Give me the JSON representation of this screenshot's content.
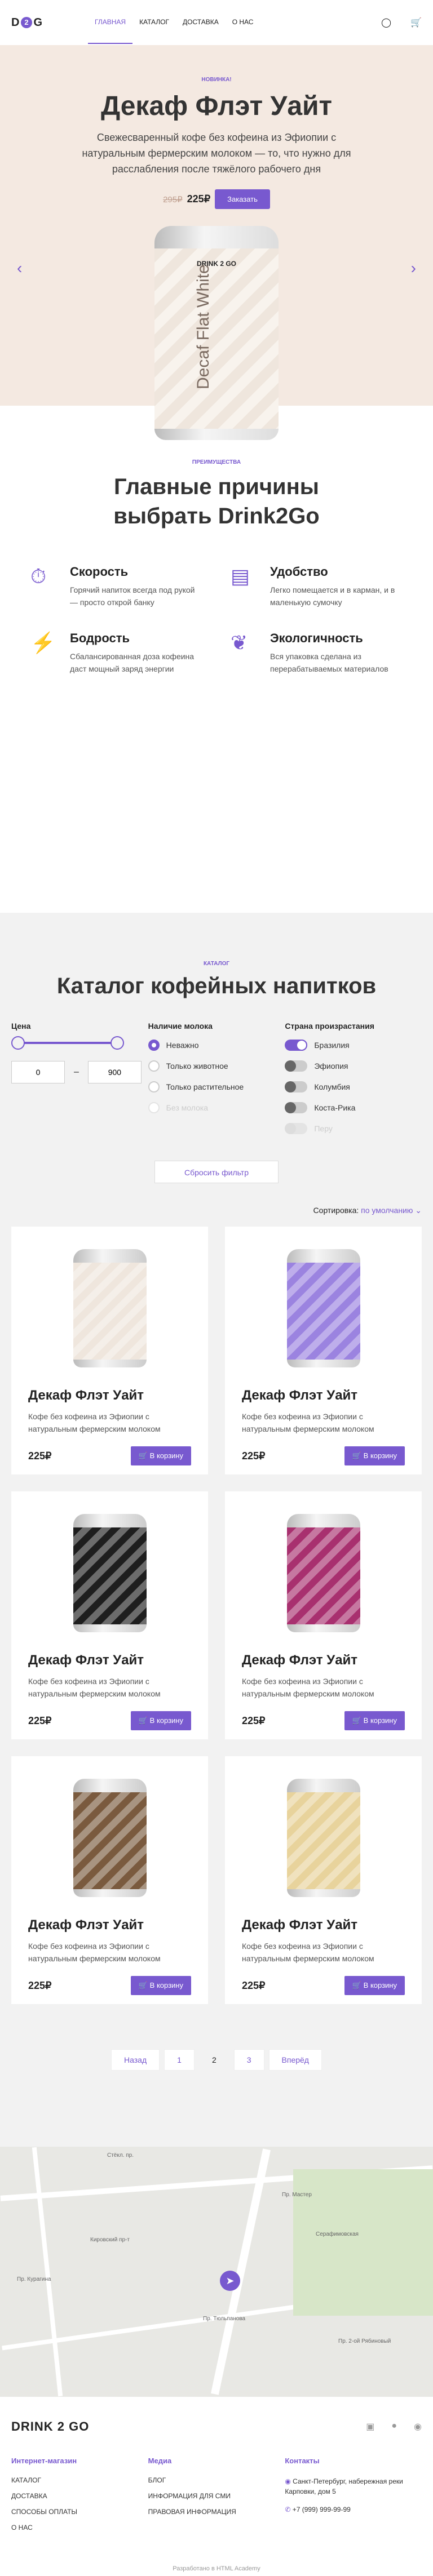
{
  "header": {
    "logo_left": "D",
    "logo_o": "2",
    "logo_right": "G",
    "nav": [
      "ГЛАВНАЯ",
      "КАТАЛОГ",
      "ДОСТАВКА",
      "О НАС"
    ]
  },
  "hero": {
    "badge": "НОВИНКА!",
    "title": "Декаф Флэт Уайт",
    "desc": "Свежесваренный кофе без кофеина из Эфиопии с натуральным фермерским молоком — то, что нужно для расслабления после тяжёлого рабочего дня",
    "old_price": "295₽",
    "price": "225₽",
    "button": "Заказать",
    "can_brand": "DRINK 2 GO",
    "can_text": "Decaf Flat White"
  },
  "benefits": {
    "badge": "ПРЕИМУЩЕСТВА",
    "title": "Главные причины выбрать Drink2Go",
    "items": [
      {
        "title": "Скорость",
        "text": "Горячий напиток всегда под рукой — просто открой банку"
      },
      {
        "title": "Удобство",
        "text": "Легко помещается и в карман, и в маленькую сумочку"
      },
      {
        "title": "Бодрость",
        "text": "Сбалансированная доза кофеина даст мощный заряд энергии"
      },
      {
        "title": "Экологичность",
        "text": "Вся упаковка сделана из перерабатываемых материалов"
      }
    ]
  },
  "catalog": {
    "badge": "КАТАЛОГ",
    "title": "Каталог кофейных напитков",
    "price_title": "Цена",
    "price_min": "0",
    "price_max": "900",
    "milk_title": "Наличие молока",
    "milk": [
      "Неважно",
      "Только животное",
      "Только растительное",
      "Без молока"
    ],
    "country_title": "Страна произрастания",
    "countries": [
      "Бразилия",
      "Эфиопия",
      "Колумбия",
      "Коста-Рика",
      "Перу"
    ],
    "reset": "Сбросить фильтр",
    "sort_label": "Сортировка:",
    "sort_value": "по умолчанию",
    "products": [
      {
        "title": "Декаф Флэт Уайт",
        "text": "Кофе без кофеина из Эфиопии с натуральным фермерским молоком",
        "price": "225₽",
        "btn": "В корзину",
        "color": "#efe6dd"
      },
      {
        "title": "Декаф Флэт Уайт",
        "text": "Кофе без кофеина из Эфиопии с натуральным фермерским молоком",
        "price": "225₽",
        "btn": "В корзину",
        "color": "#9b83e0"
      },
      {
        "title": "Декаф Флэт Уайт",
        "text": "Кофе без кофеина из Эфиопии с натуральным фермерским молоком",
        "price": "225₽",
        "btn": "В корзину",
        "color": "#1e1e1e"
      },
      {
        "title": "Декаф Флэт Уайт",
        "text": "Кофе без кофеина из Эфиопии с натуральным фермерским молоком",
        "price": "225₽",
        "btn": "В корзину",
        "color": "#a8306f"
      },
      {
        "title": "Декаф Флэт Уайт",
        "text": "Кофе без кофеина из Эфиопии с натуральным фермерским молоком",
        "price": "225₽",
        "btn": "В корзину",
        "color": "#7a5a3e"
      },
      {
        "title": "Декаф Флэт Уайт",
        "text": "Кофе без кофеина из Эфиопии с натуральным фермерским молоком",
        "price": "225₽",
        "btn": "В корзину",
        "color": "#e8d39c"
      }
    ],
    "pagination": {
      "prev": "Назад",
      "pages": [
        "1",
        "2",
        "3"
      ],
      "next": "Вперёд"
    }
  },
  "map": {
    "labels": [
      "Стёкл. пр.",
      "Пр. Мастер",
      "Серафимовская",
      "Кировский пр-т",
      "Пр. Курагина",
      "Пр. Тюльпанова",
      "Пр. 2-ой Рябиновый"
    ]
  },
  "footer": {
    "logo": "DRINK 2 GO",
    "col1_title": "Интернет-магазин",
    "col1": [
      "КАТАЛОГ",
      "ДОСТАВКА",
      "СПОСОБЫ ОПЛАТЫ",
      "О НАС"
    ],
    "col2_title": "Медиа",
    "col2": [
      "БЛОГ",
      "ИНФОРМАЦИЯ ДЛЯ СМИ",
      "ПРАВОВАЯ ИНФОРМАЦИЯ"
    ],
    "col3_title": "Контакты",
    "address": "Санкт-Петербург, набережная реки Карповки, дом 5",
    "phone": "+7 (999) 999-99-99",
    "copyright": "Разработано в HTML Academy"
  }
}
